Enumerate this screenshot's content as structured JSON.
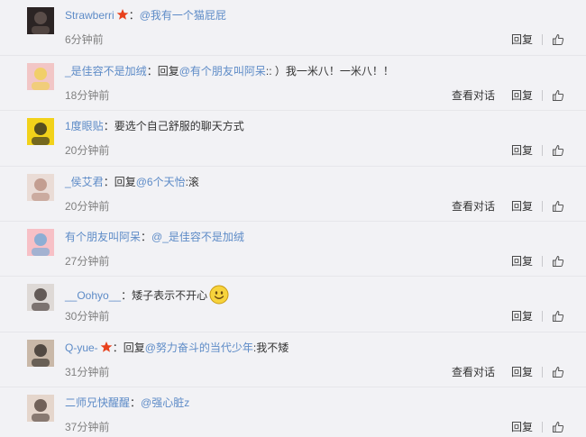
{
  "colors": {
    "link": "#5d8bc7",
    "text": "#333333",
    "time": "#808080",
    "vip": "#e8411c"
  },
  "comments": [
    {
      "user": "Strawberri",
      "vip": true,
      "sep": "：",
      "parts": [
        {
          "t": "mention",
          "v": "@我有一个猫屁屁"
        }
      ],
      "time": "6分钟前",
      "view": "",
      "reply": "回复",
      "emoji": false
    },
    {
      "user": "_是佳容不是加绒",
      "vip": false,
      "sep": "：",
      "parts": [
        {
          "t": "text",
          "v": "回复"
        },
        {
          "t": "mention",
          "v": "@有个朋友叫阿呆"
        },
        {
          "t": "text",
          "v": ":: ）我一米八！一米八！！"
        }
      ],
      "time": "18分钟前",
      "view": "查看对话",
      "reply": "回复",
      "emoji": false
    },
    {
      "user": "1度眼贴",
      "vip": false,
      "sep": "：",
      "parts": [
        {
          "t": "text",
          "v": "要选个自己舒服的聊天方式"
        }
      ],
      "time": "20分钟前",
      "view": "",
      "reply": "回复",
      "emoji": false
    },
    {
      "user": "_侯艾君",
      "vip": false,
      "sep": "：",
      "parts": [
        {
          "t": "text",
          "v": "回复"
        },
        {
          "t": "mention",
          "v": "@6个天怡"
        },
        {
          "t": "text",
          "v": ":滚"
        }
      ],
      "time": "20分钟前",
      "view": "查看对话",
      "reply": "回复",
      "emoji": false
    },
    {
      "user": "有个朋友叫阿呆",
      "vip": false,
      "sep": "：",
      "parts": [
        {
          "t": "mention",
          "v": "@_是佳容不是加绒"
        }
      ],
      "time": "27分钟前",
      "view": "",
      "reply": "回复",
      "emoji": false
    },
    {
      "user": "__Oohyo__",
      "vip": false,
      "sep": "：",
      "parts": [
        {
          "t": "text",
          "v": "矮子表示不开心"
        }
      ],
      "time": "30分钟前",
      "view": "",
      "reply": "回复",
      "emoji": true
    },
    {
      "user": "Q-yue-",
      "vip": true,
      "sep": "：",
      "parts": [
        {
          "t": "text",
          "v": "回复"
        },
        {
          "t": "mention",
          "v": "@努力奋斗的当代少年"
        },
        {
          "t": "text",
          "v": ":我不矮"
        }
      ],
      "time": "31分钟前",
      "view": "查看对话",
      "reply": "回复",
      "emoji": false
    },
    {
      "user": "二师兄快醒醒",
      "vip": false,
      "sep": "：",
      "parts": [
        {
          "t": "mention",
          "v": "@强心脏z"
        }
      ],
      "time": "37分钟前",
      "view": "",
      "reply": "回复",
      "emoji": false
    }
  ],
  "icons": {
    "like": "thumbs-up-icon",
    "vip": "vip-badge-icon",
    "emoji": "smiley-emoji-icon"
  }
}
